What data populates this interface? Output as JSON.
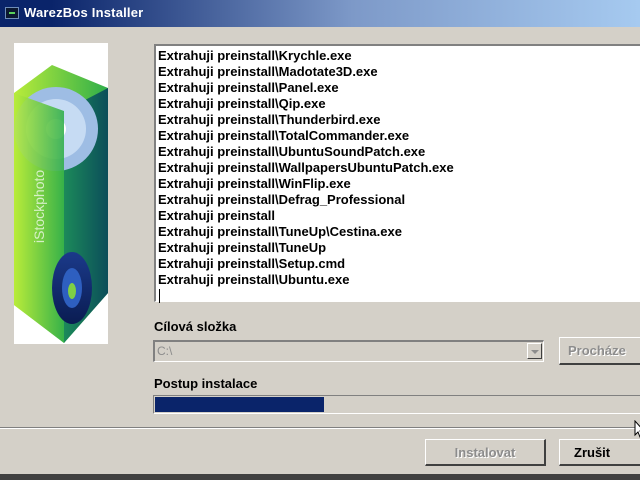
{
  "window": {
    "title": "WarezBos Installer",
    "icon": "terminal-icon"
  },
  "banner": {
    "icon": "cd-box-icon",
    "watermark": "iStockphoto"
  },
  "log": {
    "lines": [
      "Extrahuji preinstall\\Krychle.exe",
      "Extrahuji preinstall\\Madotate3D.exe",
      "Extrahuji preinstall\\Panel.exe",
      "Extrahuji preinstall\\Qip.exe",
      "Extrahuji preinstall\\Thunderbird.exe",
      "Extrahuji preinstall\\TotalCommander.exe",
      "Extrahuji preinstall\\UbuntuSoundPatch.exe",
      "Extrahuji preinstall\\WallpapersUbuntuPatch.exe",
      "Extrahuji preinstall\\WinFlip.exe",
      "Extrahuji preinstall\\Defrag_Professional",
      "Extrahuji preinstall",
      "Extrahuji preinstall\\TuneUp\\Cestina.exe",
      "Extrahuji preinstall\\TuneUp",
      "Extrahuji preinstall\\Setup.cmd",
      "Extrahuji preinstall\\Ubuntu.exe"
    ]
  },
  "destination": {
    "label": "Cílová složka",
    "value": "C:\\",
    "browse_label": "Procháze",
    "enabled": false
  },
  "progress": {
    "label": "Postup instalace",
    "fraction": 0.34,
    "color": "#0a246a"
  },
  "buttons": {
    "install_label": "Instalovat",
    "cancel_label": "Zrušit"
  }
}
